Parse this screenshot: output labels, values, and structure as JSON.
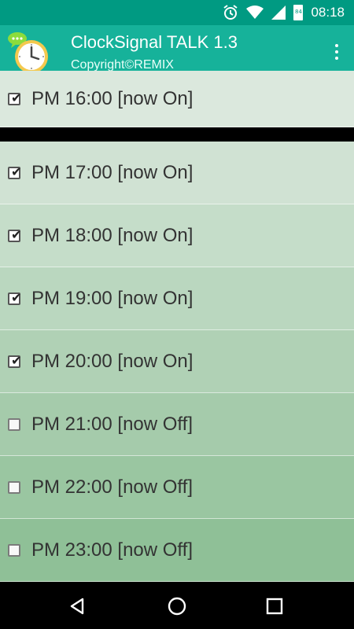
{
  "status_bar": {
    "time": "08:18",
    "icons": [
      "alarm-icon",
      "wifi-icon",
      "signal-icon",
      "battery-icon"
    ],
    "battery_level": "84"
  },
  "app_bar": {
    "title": "ClockSignal TALK 1.3",
    "subtitle": "Copyright©REMIX",
    "logo": "clock-speech-logo",
    "menu_icon": "overflow-menu-icon"
  },
  "items": [
    {
      "label": "PM 16:00 [now On]",
      "checked": true
    },
    {
      "label": "PM 17:00 [now On]",
      "checked": true
    },
    {
      "label": "PM 18:00 [now On]",
      "checked": true
    },
    {
      "label": "PM 19:00 [now On]",
      "checked": true
    },
    {
      "label": "PM 20:00 [now On]",
      "checked": true
    },
    {
      "label": "PM 21:00 [now Off]",
      "checked": false
    },
    {
      "label": "PM 22:00 [now Off]",
      "checked": false
    },
    {
      "label": "PM 23:00 [now Off]",
      "checked": false
    }
  ],
  "nav_bar": {
    "buttons": [
      "back-icon",
      "home-icon",
      "recents-icon"
    ]
  },
  "colors": {
    "status_bar": "#009a82",
    "app_bar": "#16b29a",
    "list_top": "#dbe8dd",
    "list_bottom": "#8fc097"
  }
}
